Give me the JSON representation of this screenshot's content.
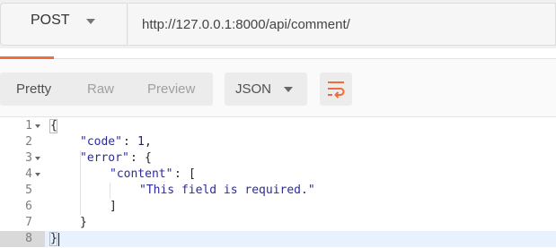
{
  "request": {
    "method": "POST",
    "url": "http://127.0.0.1:8000/api/comment/"
  },
  "response_view": {
    "tabs": [
      "Pretty",
      "Raw",
      "Preview"
    ],
    "active_tab": "Pretty",
    "format": "JSON",
    "icons": {
      "wrap": "wrap-lines-icon",
      "method_caret": "chevron-down-icon",
      "format_caret": "chevron-down-icon"
    },
    "accent_color": "#f26b3a"
  },
  "editor": {
    "active_line": 8,
    "lines": [
      {
        "num": "1",
        "fold": true,
        "text": "{"
      },
      {
        "num": "2",
        "fold": false,
        "key": "\"code\"",
        "sep": ": ",
        "value": "1",
        "tail": ","
      },
      {
        "num": "3",
        "fold": true,
        "key": "\"error\"",
        "sep": ": ",
        "tail": "{"
      },
      {
        "num": "4",
        "fold": true,
        "key": "\"content\"",
        "sep": ": ",
        "tail": "["
      },
      {
        "num": "5",
        "fold": false,
        "value": "\"This field is required.\""
      },
      {
        "num": "6",
        "fold": false,
        "text": "]"
      },
      {
        "num": "7",
        "fold": false,
        "text": "}"
      },
      {
        "num": "8",
        "fold": false,
        "text": "}"
      }
    ]
  }
}
